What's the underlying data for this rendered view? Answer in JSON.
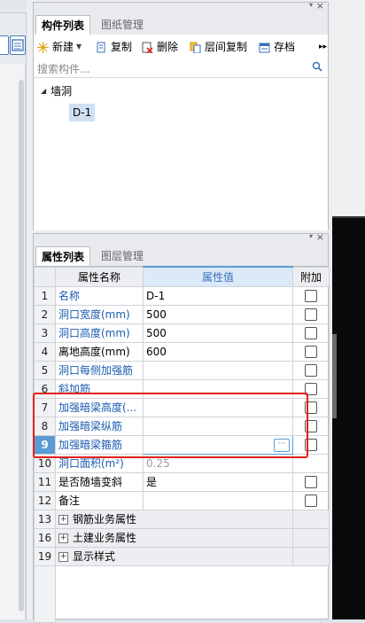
{
  "top_panel": {
    "tabs": [
      {
        "label": "构件列表"
      },
      {
        "label": "图纸管理"
      }
    ],
    "toolbar": {
      "new": "新建",
      "copy": "复制",
      "delete": "删除",
      "floor_copy": "层间复制",
      "archive": "存档",
      "more": "▸▸"
    },
    "search": {
      "placeholder": "搜索构件..."
    },
    "tree": {
      "root": "墙洞",
      "child": "D-1"
    }
  },
  "bottom_panel": {
    "tabs": [
      {
        "label": "属性列表"
      },
      {
        "label": "图层管理"
      }
    ],
    "headers": {
      "name": "属性名称",
      "value": "属性值",
      "extra": "附加"
    },
    "rows": [
      {
        "num": "1",
        "name": "名称",
        "value": "D-1"
      },
      {
        "num": "2",
        "name": "洞口宽度(mm)",
        "value": "500"
      },
      {
        "num": "3",
        "name": "洞口高度(mm)",
        "value": "500"
      },
      {
        "num": "4",
        "name": "离地高度(mm)",
        "value": "600"
      },
      {
        "num": "5",
        "name": "洞口每侧加强筋",
        "value": ""
      },
      {
        "num": "6",
        "name": "斜加筋",
        "value": ""
      },
      {
        "num": "7",
        "name": "加强暗梁高度(...",
        "value": ""
      },
      {
        "num": "8",
        "name": "加强暗梁纵筋",
        "value": ""
      },
      {
        "num": "9",
        "name": "加强暗梁箍筋",
        "value": ""
      },
      {
        "num": "10",
        "name": "洞口面积(m²)",
        "value": "0.25"
      },
      {
        "num": "11",
        "name": "是否随墙变斜",
        "value": "是"
      },
      {
        "num": "12",
        "name": "备注",
        "value": ""
      }
    ],
    "groups": [
      {
        "num": "13",
        "name": "钢筋业务属性"
      },
      {
        "num": "16",
        "name": "土建业务属性"
      },
      {
        "num": "19",
        "name": "显示样式"
      }
    ],
    "ellipsis": "···"
  },
  "colors": {
    "accent": "#5b9bd5",
    "link": "#1a5bb0",
    "highlight": "#e0201b"
  }
}
